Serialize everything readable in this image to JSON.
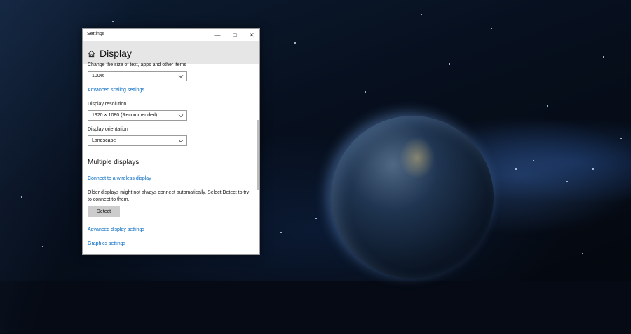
{
  "window": {
    "title": "Settings",
    "controls": {
      "minimize": "—",
      "maximize": "□",
      "close": "✕"
    }
  },
  "header": {
    "icon": "home-icon",
    "title": "Display"
  },
  "scale": {
    "label": "Change the size of text, apps and other items",
    "value": "100%"
  },
  "links": {
    "advanced_scaling": "Advanced scaling settings",
    "wireless_display": "Connect to a wireless display",
    "advanced_display": "Advanced display settings",
    "graphics": "Graphics settings"
  },
  "resolution": {
    "label": "Display resolution",
    "value": "1920 × 1080 (Recommended)"
  },
  "orientation": {
    "label": "Display orientation",
    "value": "Landscape"
  },
  "multiple_displays": {
    "heading": "Multiple displays",
    "description": "Older displays might not always connect automatically. Select Detect to try to connect to them.",
    "detect_button": "Detect"
  },
  "colors": {
    "link": "#0067c0",
    "header_bg": "#e6e6e6",
    "button_bg": "#cccccc"
  }
}
